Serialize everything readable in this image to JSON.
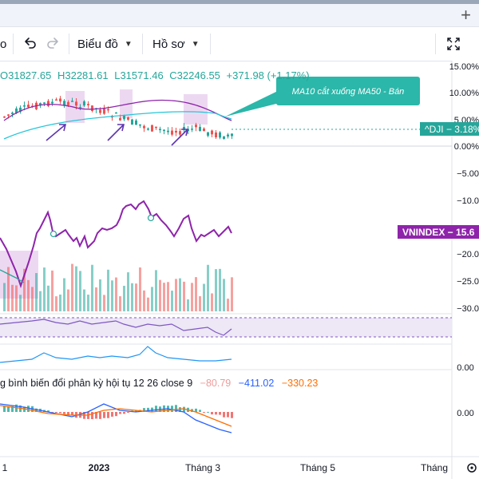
{
  "toolbar": {
    "cut_label": "o",
    "undo_icon": "undo-icon",
    "redo_icon": "redo-icon",
    "chart_type_label": "Biểu đồ",
    "profile_label": "Hồ sơ",
    "fullscreen_icon": "fullscreen-icon",
    "new_tab_icon": "plus-icon"
  },
  "ohlc": {
    "open": "O31827.65",
    "high": "H32281.61",
    "low": "L31571.46",
    "close": "C32246.55",
    "change": "+371.98 (+1.17%)"
  },
  "annotation": {
    "text": "MA10 cắt xuống MA50 - Bán"
  },
  "badges": {
    "dji": "^DJI − 3.18%",
    "vnindex": "VNINDEX − 15.6"
  },
  "price_axis": [
    "15.00%",
    "10.00%",
    "5.00%",
    "0.00%",
    "−5.00",
    "−10.0",
    "−15.0",
    "−20.0",
    "−25.0",
    "−30.0"
  ],
  "indicator_axis": {
    "osc1": "0.00",
    "osc2": "0.00"
  },
  "macd": {
    "title": "g bình biến đổi phân kỳ hội tụ 12 26 close 9",
    "histogram": "−80.79",
    "macd": "−411.02",
    "signal": "−330.23"
  },
  "time_axis": [
    "1",
    "2023",
    "Tháng 3",
    "Tháng 5",
    "Tháng"
  ],
  "colors": {
    "candle_up": "#26a69a",
    "candle_down": "#ef5350",
    "vnindex": "#8e24aa",
    "ma_cyan": "#26c6da",
    "annotation_bg": "#2bb7a9",
    "macd_blue": "#2962ff",
    "signal_orange": "#ff6d00",
    "highlight": "#e1bee7"
  }
}
